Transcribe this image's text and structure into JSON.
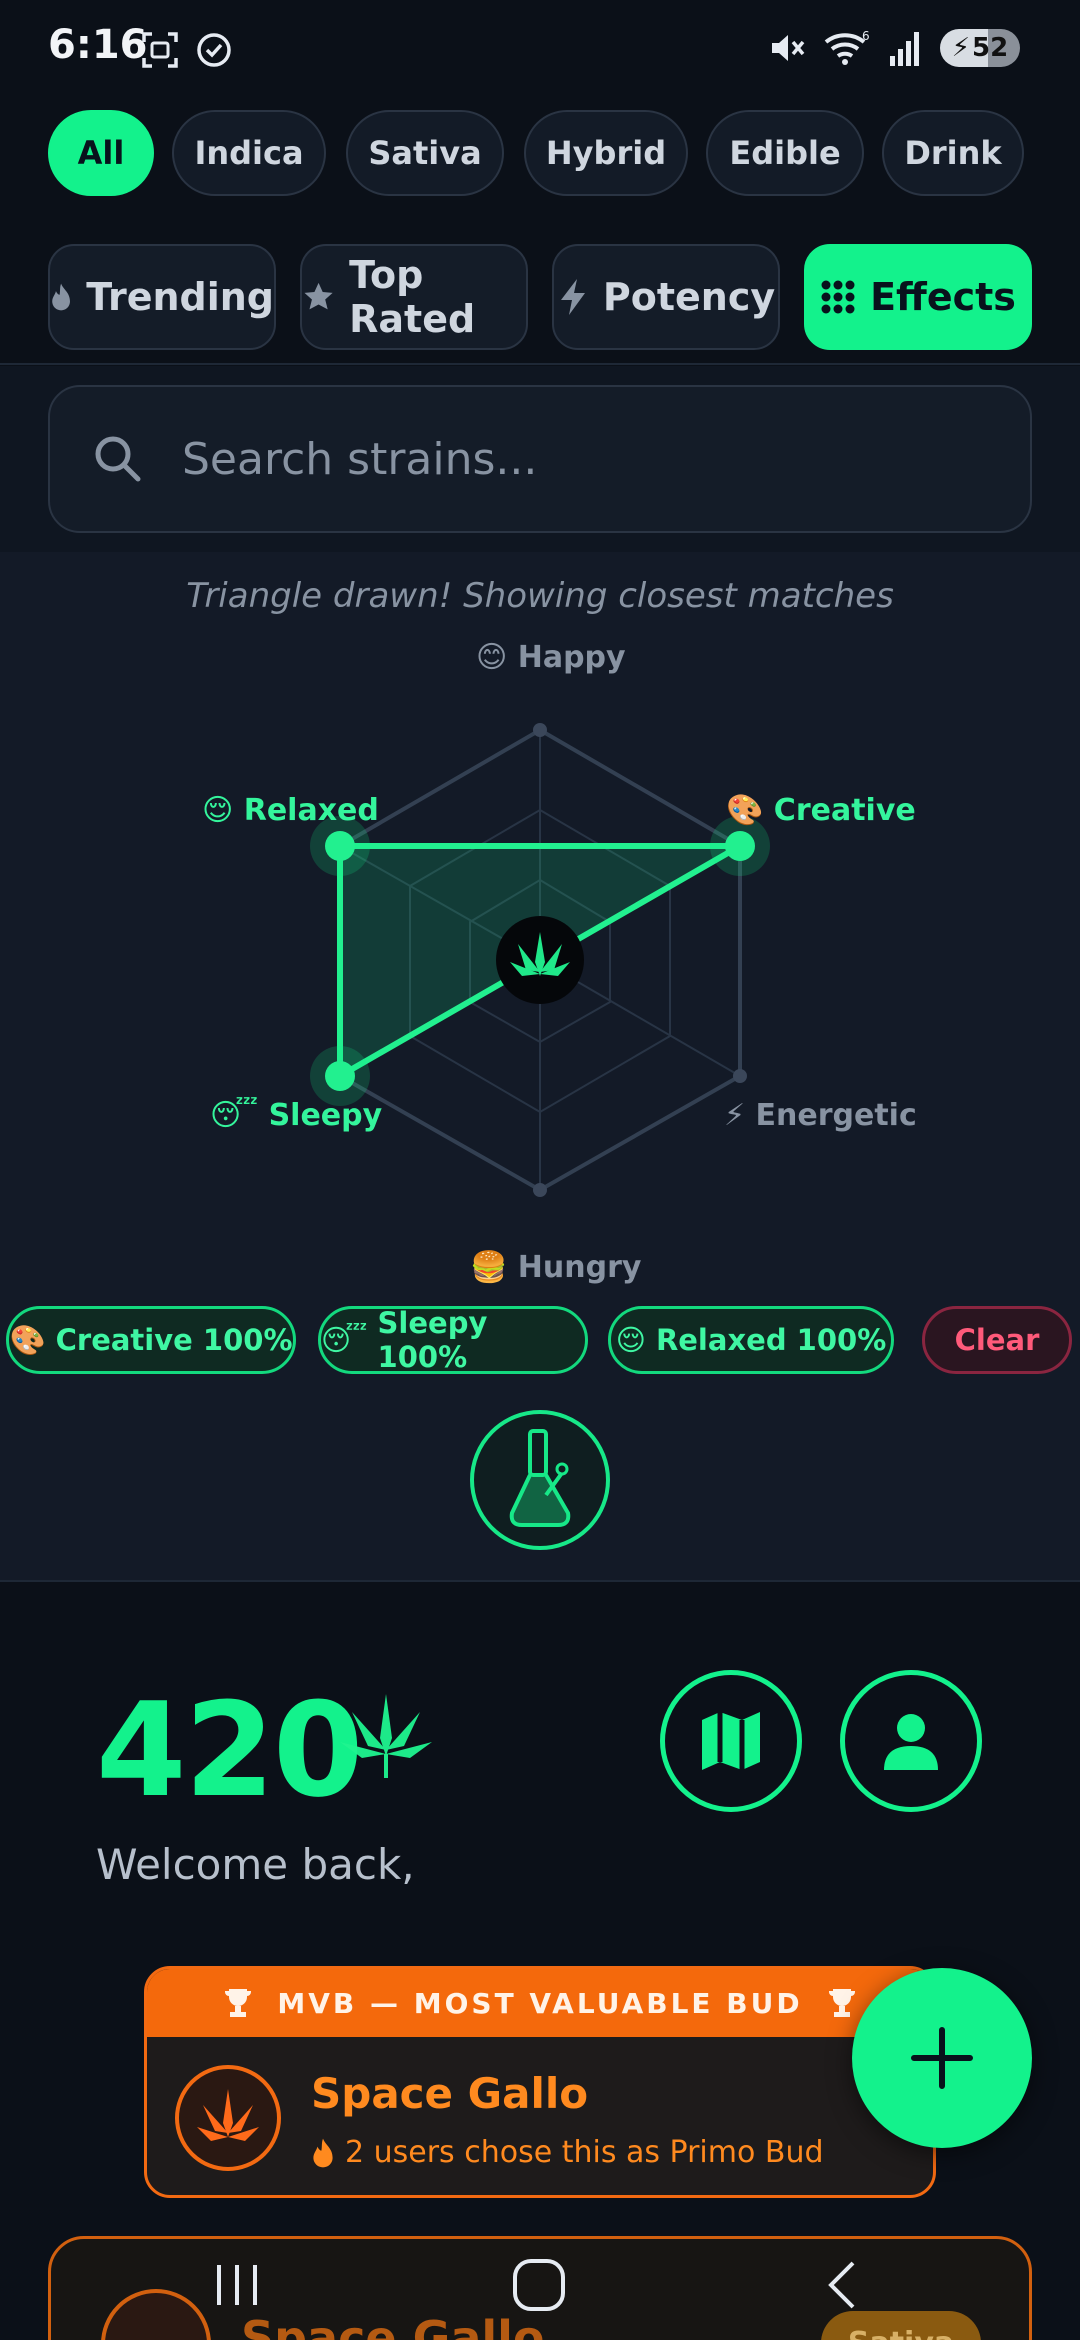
{
  "status": {
    "time": "6:16",
    "battery": "52",
    "wifi_badge": "6"
  },
  "categories": [
    {
      "label": "All",
      "active": true
    },
    {
      "label": "Indica"
    },
    {
      "label": "Sativa"
    },
    {
      "label": "Hybrid"
    },
    {
      "label": "Edible"
    },
    {
      "label": "Drink"
    }
  ],
  "sort_tabs": [
    {
      "label": "Trending",
      "icon": "flame-icon"
    },
    {
      "label": "Top Rated",
      "icon": "star-icon"
    },
    {
      "label": "Potency",
      "icon": "lightning-icon"
    },
    {
      "label": "Effects",
      "icon": "grid-icon",
      "active": true
    }
  ],
  "search": {
    "placeholder": "Search strains..."
  },
  "effects": {
    "hint": "Triangle drawn! Showing closest matches",
    "axes": {
      "happy": "😊 Happy",
      "creative": "🎨 Creative",
      "energetic": "⚡ Energetic",
      "hungry": "🍔 Hungry",
      "sleepy": "😴 Sleepy",
      "relaxed": "😌 Relaxed"
    },
    "selected": [
      "Creative",
      "Sleepy",
      "Relaxed"
    ],
    "pills": [
      {
        "emoji": "🎨",
        "label": "Creative 100%"
      },
      {
        "emoji": "😴",
        "label": "Sleepy 100%"
      },
      {
        "emoji": "😌",
        "label": "Relaxed 100%"
      }
    ],
    "clear_label": "Clear"
  },
  "dashboard": {
    "count": "420",
    "welcome": "Welcome back,"
  },
  "mvb": {
    "header": "MVB — MOST VALUABLE BUD",
    "name": "Space Gallo",
    "subtitle": "2 users chose this as Primo Bud"
  },
  "bottom_card": {
    "name": "Space Gallo",
    "badge": "Sativa"
  },
  "colors": {
    "accent": "#13f28c",
    "orange": "#f4690c",
    "background": "#0b1018"
  }
}
